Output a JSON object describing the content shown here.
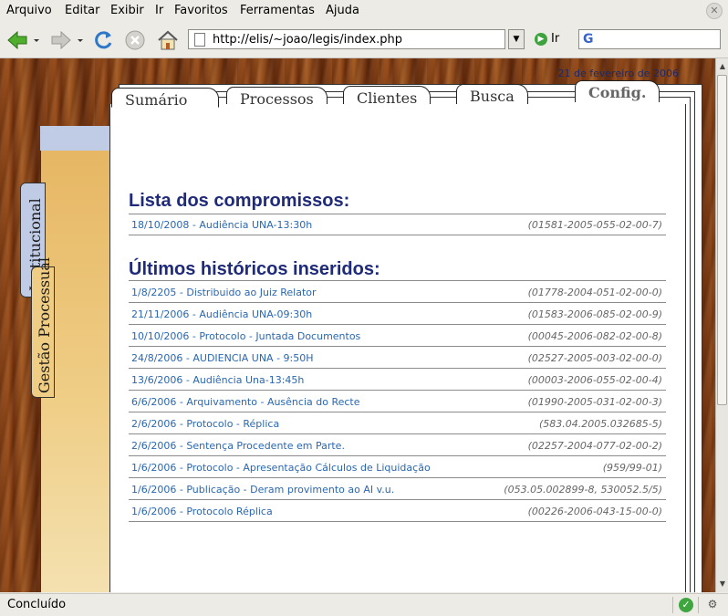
{
  "menu": [
    {
      "label": "Arquivo"
    },
    {
      "label": "Editar"
    },
    {
      "label": "Exibir"
    },
    {
      "label": "Ir"
    },
    {
      "label": "Favoritos"
    },
    {
      "label": "Ferramentas"
    },
    {
      "label": "Ajuda"
    }
  ],
  "toolbar": {
    "url": "http://elis/~joao/legis/index.php",
    "go_label": "Ir",
    "search_placeholder": ""
  },
  "tabs": [
    {
      "label": "Sumário",
      "active": true
    },
    {
      "label": "Processos"
    },
    {
      "label": "Clientes"
    },
    {
      "label": "Busca"
    },
    {
      "label": "Config."
    }
  ],
  "side_tabs": [
    {
      "label": "Institucional"
    },
    {
      "label": "Gestão Processual"
    }
  ],
  "date": "21 de fevereiro de 2006",
  "compromissos": {
    "title": "Lista dos compromissos:",
    "items": [
      {
        "text": "18/10/2008 - Audiência UNA-13:30h",
        "proc": "(01581-2005-055-02-00-7)"
      }
    ]
  },
  "historicos": {
    "title": "Últimos históricos inseridos:",
    "items": [
      {
        "text": "1/8/2205 - Distribuido ao Juiz Relator",
        "proc": "(01778-2004-051-02-00-0)"
      },
      {
        "text": "21/11/2006 - Audiência UNA-09:30h",
        "proc": "(01583-2006-085-02-00-9)"
      },
      {
        "text": "10/10/2006 - Protocolo - Juntada Documentos",
        "proc": "(00045-2006-082-02-00-8)"
      },
      {
        "text": "24/8/2006 - AUDIENCIA UNA - 9:50H",
        "proc": "(02527-2005-003-02-00-0)"
      },
      {
        "text": "13/6/2006 - Audiência Una-13:45h",
        "proc": "(00003-2006-055-02-00-4)"
      },
      {
        "text": "6/6/2006 - Arquivamento - Ausência do Recte",
        "proc": "(01990-2005-031-02-00-3)"
      },
      {
        "text": "2/6/2006 - Protocolo - Réplica",
        "proc": "(583.04.2005.032685-5)"
      },
      {
        "text": "2/6/2006 - Sentença Procedente em Parte.",
        "proc": "(02257-2004-077-02-00-2)"
      },
      {
        "text": "1/6/2006 - Protocolo - Apresentação Cálculos de Liquidação",
        "proc": "(959/99-01)"
      },
      {
        "text": "1/6/2006 - Publicação - Deram provimento ao AI v.u.",
        "proc": "(053.05.002899-8, 530052.5/5)"
      },
      {
        "text": "1/6/2006 - Protocolo Réplica",
        "proc": "(00226-2006-043-15-00-0)"
      }
    ]
  },
  "status": {
    "text": "Concluído"
  }
}
